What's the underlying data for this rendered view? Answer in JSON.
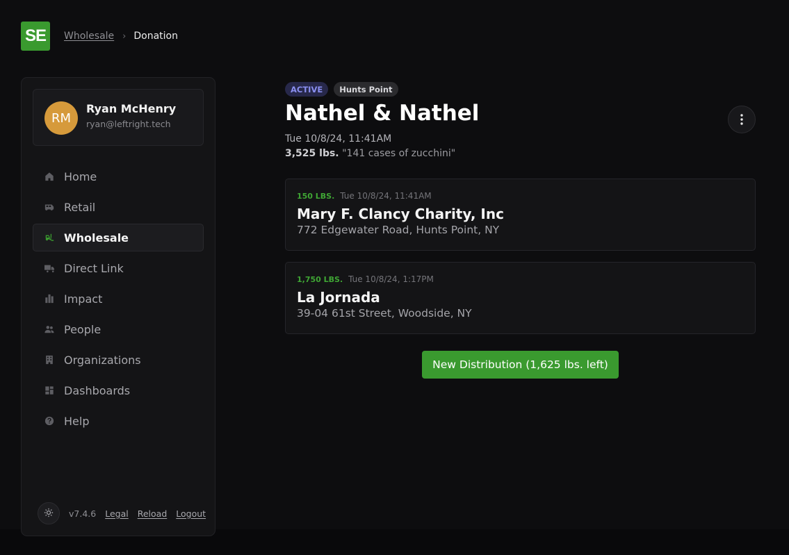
{
  "logo": {
    "text": "SE",
    "color": "#3a9a2f"
  },
  "breadcrumb": {
    "parent": "Wholesale",
    "separator": "›",
    "current": "Donation"
  },
  "user": {
    "initials": "RM",
    "name": "Ryan McHenry",
    "email": "ryan@leftright.tech",
    "avatar_color": "#d69a3b"
  },
  "nav": {
    "items": [
      {
        "label": "Home",
        "icon": "home-icon",
        "active": false
      },
      {
        "label": "Retail",
        "icon": "van-icon",
        "active": false
      },
      {
        "label": "Wholesale",
        "icon": "forklift-icon",
        "active": true
      },
      {
        "label": "Direct Link",
        "icon": "truck-icon",
        "active": false
      },
      {
        "label": "Impact",
        "icon": "bar-chart-icon",
        "active": false
      },
      {
        "label": "People",
        "icon": "people-icon",
        "active": false
      },
      {
        "label": "Organizations",
        "icon": "building-icon",
        "active": false
      },
      {
        "label": "Dashboards",
        "icon": "dashboard-icon",
        "active": false
      },
      {
        "label": "Help",
        "icon": "help-icon",
        "active": false
      }
    ]
  },
  "footer": {
    "theme_icon": "sun-icon",
    "version": "v7.4.6",
    "legal": "Legal",
    "reload": "Reload",
    "logout": "Logout"
  },
  "donation": {
    "status": "ACTIVE",
    "location": "Hunts Point",
    "title": "Nathel & Nathel",
    "date": "Tue 10/8/24, 11:41AM",
    "weight": "3,525 lbs.",
    "description": "\"141 cases of zucchini\""
  },
  "distributions": [
    {
      "lbs": "150 LBS.",
      "date": "Tue 10/8/24, 11:41AM",
      "name": "Mary F. Clancy Charity, Inc",
      "address": "772 Edgewater Road, Hunts Point, NY"
    },
    {
      "lbs": "1,750 LBS.",
      "date": "Tue 10/8/24, 1:17PM",
      "name": "La Jornada",
      "address": "39-04 61st Street, Woodside, NY"
    }
  ],
  "actions": {
    "new_distribution": "New Distribution (1,625 lbs. left)"
  },
  "colors": {
    "accent": "#3a9a2f",
    "background": "#0d0d0f",
    "badge_active": "#8a8ff0"
  }
}
